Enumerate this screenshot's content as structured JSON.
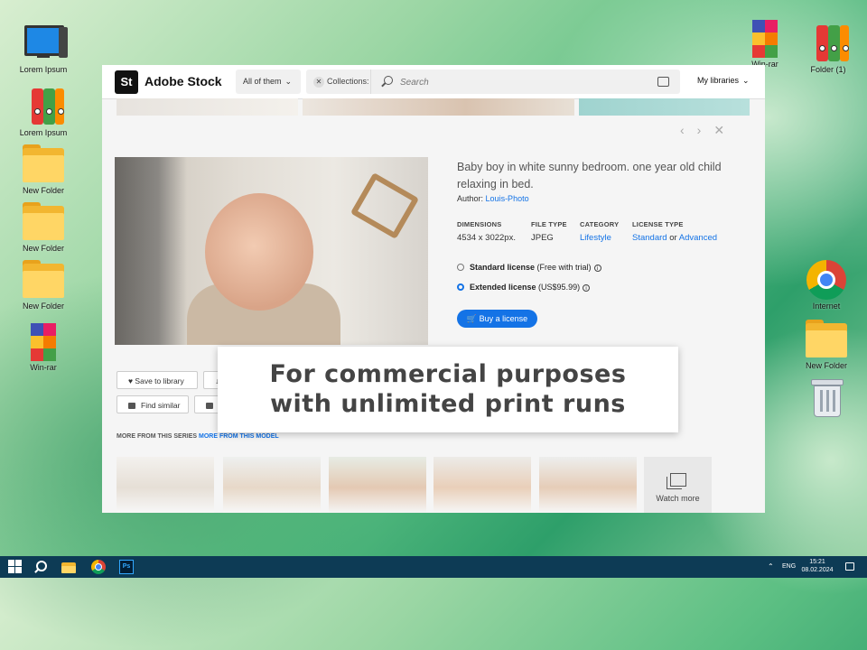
{
  "desktop": {
    "left_icons": [
      {
        "name": "computer-icon",
        "label": "Lorem Ipsum"
      },
      {
        "name": "binders-icon",
        "label": "Lorem Ipsum"
      },
      {
        "name": "folder-icon",
        "label": "New Folder"
      },
      {
        "name": "folder-icon",
        "label": "New Folder"
      },
      {
        "name": "folder-icon",
        "label": "New Folder"
      },
      {
        "name": "winrar-icon",
        "label": "Win-rar"
      }
    ],
    "top_right_icons": [
      {
        "name": "winrar-icon",
        "label": "Win-rar"
      },
      {
        "name": "binders-icon",
        "label": "Folder (1)"
      }
    ],
    "right_icons": [
      {
        "name": "chrome-icon",
        "label": "Internet"
      },
      {
        "name": "folder-icon",
        "label": "New Folder"
      },
      {
        "name": "recycle-bin-icon",
        "label": ""
      }
    ]
  },
  "browser": {
    "logo_mark": "St",
    "logo_text": "Adobe Stock",
    "filter_dropdown": "All of them",
    "collections_chip": "Collections:",
    "search_placeholder": "Search",
    "my_libraries": "My libraries"
  },
  "asset": {
    "title": "Baby boy in white sunny bedroom. one year old child relaxing in bed.",
    "author_label": "Author:",
    "author_name": "Louis-Photo",
    "dimensions_label": "DIMENSIONS",
    "dimensions_value": "4534 x 3022px.",
    "file_type_label": "FILE TYPE",
    "file_type_value": "JPEG",
    "category_label": "CATEGORY",
    "category_value": "Lifestyle",
    "license_type_label": "LICENSE TYPE",
    "license_standard": "Standard",
    "license_or": "or",
    "license_advanced": "Advanced",
    "standard_license": "Standard license",
    "standard_license_note": "(Free with trial)",
    "extended_license": "Extended license",
    "extended_license_note": "(US$95.99)",
    "buy_button": "Buy a license"
  },
  "actions": {
    "save_to_library": "Save to library",
    "find_similar": "Find similar"
  },
  "series": {
    "label": "MORE FROM THIS SERIES",
    "model_link": "MORE FROM THIS MODEL",
    "watch_more": "Watch more"
  },
  "caption": {
    "line1": "For commercial purposes",
    "line2": "with unlimited print runs"
  },
  "taskbar": {
    "language": "ENG",
    "time": "15:21",
    "date": "08.02.2024"
  },
  "colors": {
    "accent": "#1473e6",
    "taskbar": "#0d3b55"
  }
}
